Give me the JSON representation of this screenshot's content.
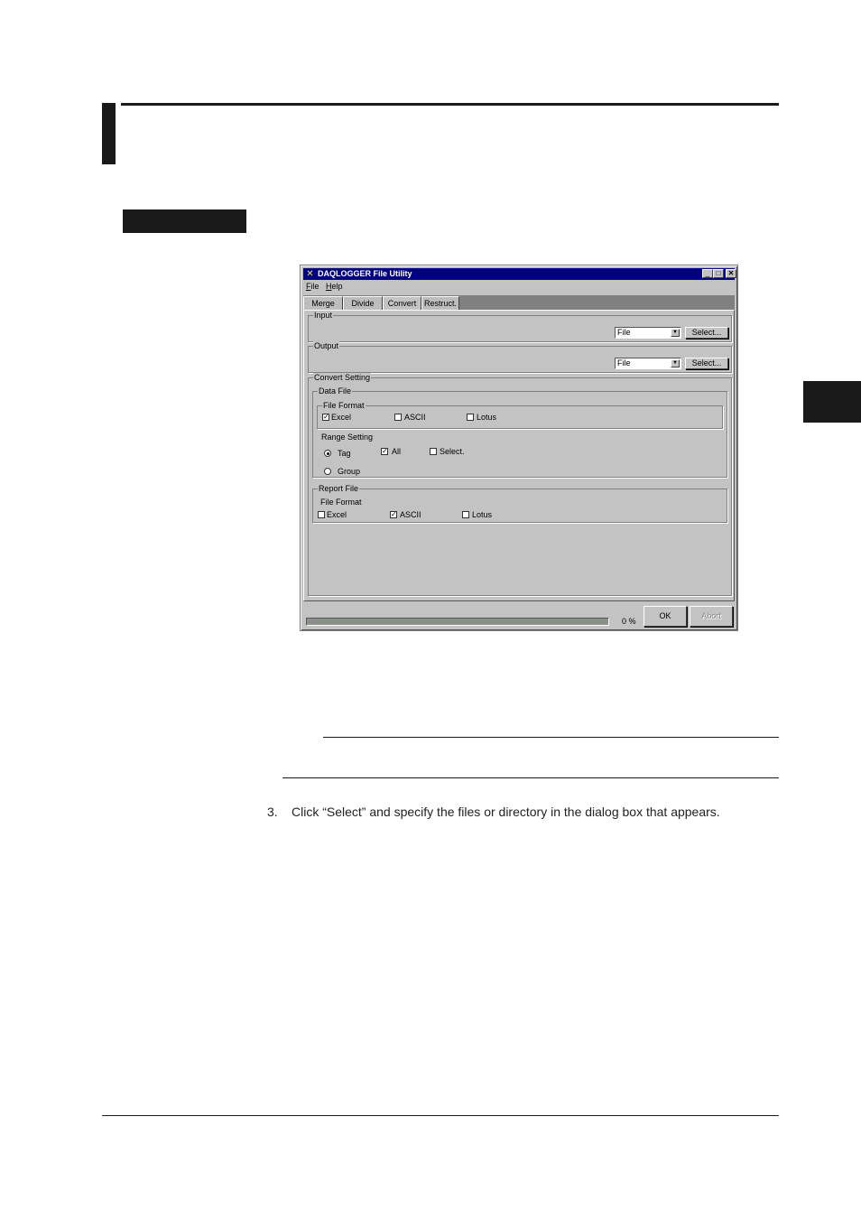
{
  "window": {
    "title": "DAQLOGGER File Utility",
    "controls": {
      "minimize": "_",
      "maximize": "□",
      "close": "✕"
    }
  },
  "menu": [
    {
      "accel": "F",
      "rest": "ile"
    },
    {
      "accel": "H",
      "rest": "elp"
    }
  ],
  "tabs": [
    "Merge",
    "Divide",
    "Convert",
    "Restruct."
  ],
  "active_tab": "Convert",
  "input": {
    "label": "Input",
    "combo_value": "File",
    "select_label": "Select..."
  },
  "output": {
    "label": "Output",
    "combo_value": "File",
    "select_label": "Select..."
  },
  "convert_setting": {
    "label": "Convert Setting",
    "data_file": {
      "label": "Data File",
      "file_format": {
        "label": "File Format",
        "excel": {
          "label": "Excel",
          "checked": true
        },
        "ascii": {
          "label": "ASCII",
          "checked": false
        },
        "lotus": {
          "label": "Lotus",
          "checked": false
        }
      },
      "range_setting": {
        "label": "Range Setting",
        "tag": {
          "label": "Tag",
          "selected": true
        },
        "group": {
          "label": "Group",
          "selected": false
        },
        "all": {
          "label": "All",
          "checked": true
        },
        "select": {
          "label": "Select.",
          "checked": false
        }
      }
    },
    "report_file": {
      "label": "Report File",
      "file_format": {
        "label": "File Format",
        "excel": {
          "label": "Excel",
          "checked": false
        },
        "ascii": {
          "label": "ASCII",
          "checked": true
        },
        "lotus": {
          "label": "Lotus",
          "checked": false
        }
      }
    }
  },
  "status": {
    "progress_percent": 0,
    "progress_text": "0 %"
  },
  "buttons": {
    "ok": "OK",
    "abort": "Abort"
  },
  "step3": {
    "number": "3.",
    "text": "Click “Select” and specify the files or directory in the dialog box that appears."
  },
  "check_glyph": "✓",
  "colors": {
    "titlebar": "#000080",
    "dialog_face": "#c3c3c3"
  }
}
